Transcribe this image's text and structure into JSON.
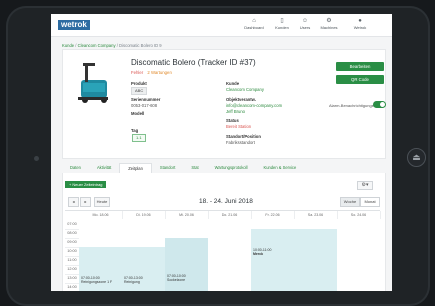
{
  "app": {
    "logo": "wetrok"
  },
  "nav": [
    {
      "label": "Dashboard",
      "icon": "home-icon"
    },
    {
      "label": "Kunden",
      "icon": "building-icon"
    },
    {
      "label": "Users",
      "icon": "users-icon"
    },
    {
      "label": "Machines",
      "icon": "machine-icon"
    },
    {
      "label": "Wetrok",
      "icon": "user-icon"
    }
  ],
  "breadcrumb": {
    "crumb1": "Kunde",
    "crumb2": "Cleancom Company",
    "current": "Discomatic Bolero ID 9"
  },
  "machine": {
    "title": "Discomatic Bolero (Tracker ID #37)",
    "status_a": "Fehler",
    "status_b": "2 Wartungen",
    "fields": {
      "produkt_label": "Produkt",
      "produkt_value": "ABC",
      "seriennummer_label": "Seriennummer",
      "seriennummer_value": "0053-017-608",
      "modell_label": "Modell",
      "modell_value": "",
      "tag_label": "Tag",
      "tag_value": "1.1",
      "kunde_label": "Kunde",
      "kunde_value": "Cleancom Company",
      "objekt_label": "Objektverantw.",
      "objekt_value": "info@cleancom-company.com",
      "objekt_value2": "Jeff Bruno",
      "status_label": "Status",
      "status_value": "Bereit Station",
      "standort_label": "Standort/Position",
      "standort_value": "Fabriksstandort"
    },
    "buttons": {
      "bearbeiten": "Bearbeiten",
      "qr": "QR Code"
    },
    "toggle_label": "Alarm-Benachrichtigungen"
  },
  "tabs": [
    "Daten",
    "Aktivität",
    "Zeitplan",
    "Standort",
    "Stat",
    "Wartungsprotokoll",
    "Kunden & Service"
  ],
  "active_tab": "Zeitplan",
  "calendar": {
    "new_button": "+ Neuer Zeiteintrag",
    "today": "Heute",
    "prev": "◂",
    "next": "▸",
    "range": "18. - 24. Juni 2018",
    "view_week": "Woche",
    "view_month": "Monat",
    "days": [
      "Mo. 18.06",
      "Di. 19.06",
      "Mi. 20.06",
      "Do. 21.06",
      "Fr. 22.06",
      "Sa. 23.06",
      "So. 24.06"
    ],
    "hours": [
      "07:00",
      "08:00",
      "09:00",
      "10:00",
      "11:00",
      "12:00",
      "13:00",
      "14:00"
    ],
    "events": [
      {
        "time": "10:00-11:00",
        "label": "Merck"
      },
      {
        "time": "07:00-10:00",
        "label": "Reinigungszone 1 F"
      },
      {
        "time": "07:00-13:00",
        "label": "Reinigung"
      },
      {
        "time": "07:00-10:00",
        "label": "Sockelzone"
      }
    ]
  }
}
